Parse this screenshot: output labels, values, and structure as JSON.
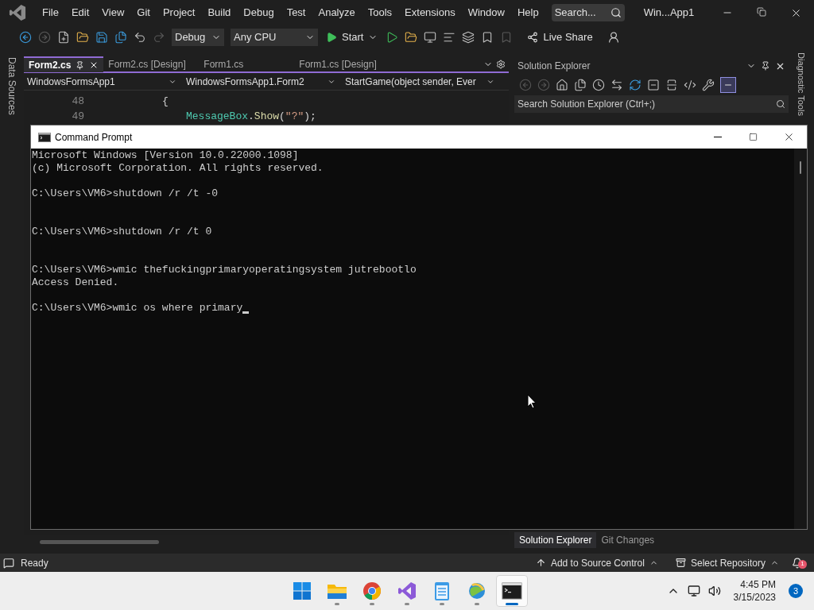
{
  "menu": {
    "items": [
      "File",
      "Edit",
      "View",
      "Git",
      "Project",
      "Build",
      "Debug",
      "Test",
      "Analyze",
      "Tools",
      "Extensions",
      "Window",
      "Help"
    ],
    "search_placeholder": "Search...",
    "title": "Win...App1"
  },
  "toolbar": {
    "configuration": "Debug",
    "platform": "Any CPU",
    "start": "Start",
    "live_share": "Live Share"
  },
  "side_left": "Data Sources",
  "side_right": "Diagnostic Tools",
  "doc_tabs": [
    {
      "label": "Form2.cs",
      "selected": true
    },
    {
      "label": "Form2.cs [Design]",
      "selected": false
    },
    {
      "label": "Form1.cs",
      "selected": false
    },
    {
      "label": "Form1.cs [Design]",
      "selected": false
    }
  ],
  "nav_bar": [
    "WindowsFormsApp1",
    "WindowsFormsApp1.Form2",
    "StartGame(object sender, Ever"
  ],
  "code_lines": [
    {
      "number": "48",
      "tokens": [
        {
          "kind": "punct",
          "text": "{"
        }
      ]
    },
    {
      "number": "49",
      "tokens": [
        {
          "kind": "type",
          "text": "MessageBox"
        },
        {
          "kind": "punct",
          "text": "."
        },
        {
          "kind": "method",
          "text": "Show"
        },
        {
          "kind": "punct",
          "text": "("
        },
        {
          "kind": "string",
          "text": "\"?\""
        },
        {
          "kind": "punct",
          "text": ");"
        }
      ]
    }
  ],
  "solution_explorer": {
    "title": "Solution Explorer",
    "search_placeholder": "Search Solution Explorer (Ctrl+;)",
    "bottom_tabs": [
      {
        "label": "Solution Explorer",
        "selected": true
      },
      {
        "label": "Git Changes",
        "selected": false
      }
    ]
  },
  "status_bar": {
    "status": "Ready",
    "source_control": "Add to Source Control",
    "repository": "Select Repository",
    "notifications": "1"
  },
  "console": {
    "title": "Command Prompt",
    "header": [
      "Microsoft Windows [Version 10.0.22000.1098]",
      "(c) Microsoft Corporation. All rights reserved."
    ],
    "entries": [
      {
        "prompt": "C:\\Users\\VM6>",
        "command": "shutdown /r /t -0"
      },
      {
        "prompt": "C:\\Users\\VM6>",
        "command": "shutdown /r /t 0"
      },
      {
        "prompt": "C:\\Users\\VM6>",
        "command": "wmic thefuckingprimaryoperatingsystem jutrebootlo",
        "output": [
          "Access Denied."
        ]
      }
    ],
    "input": {
      "prompt": "C:\\Users\\VM6>",
      "text": "wmic os where primary",
      "cursor": true
    }
  },
  "taskbar": {
    "apps": [
      {
        "kind": "start",
        "running": false,
        "active": false
      },
      {
        "kind": "files",
        "running": true,
        "active": false
      },
      {
        "kind": "browser",
        "running": true,
        "active": false
      },
      {
        "kind": "ide",
        "running": true,
        "active": false
      },
      {
        "kind": "notepad",
        "running": true,
        "active": false
      },
      {
        "kind": "globe",
        "running": true,
        "active": false
      },
      {
        "kind": "terminal",
        "running": true,
        "active": true
      }
    ],
    "time": "4:45 PM",
    "date": "3/15/2023",
    "badge": "3"
  }
}
